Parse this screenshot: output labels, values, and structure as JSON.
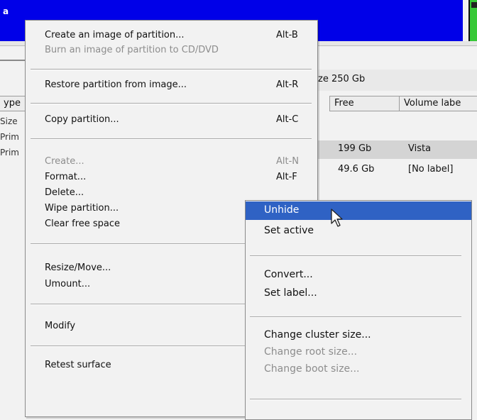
{
  "app": {
    "title_fragment": "a"
  },
  "disk": {
    "size_label": "ze 250 Gb"
  },
  "columns": {
    "type": "ype",
    "free": "Free",
    "volume_label": "Volume labe"
  },
  "left_strip": [
    "Size",
    "Prim",
    "Prim"
  ],
  "partitions": [
    {
      "free": "199 Gb",
      "label": "Vista"
    },
    {
      "free": "49.6 Gb",
      "label": "[No label]"
    }
  ],
  "menu": {
    "create_image": {
      "label": "Create an image of partition...",
      "shortcut": "Alt-B"
    },
    "burn_image": {
      "label": "Burn an image of partition to CD/DVD"
    },
    "restore": {
      "label": "Restore partition from image...",
      "shortcut": "Alt-R"
    },
    "copy": {
      "label": "Copy partition...",
      "shortcut": "Alt-C"
    },
    "create": {
      "label": "Create...",
      "shortcut": "Alt-N"
    },
    "format": {
      "label": "Format...",
      "shortcut": "Alt-F"
    },
    "delete": {
      "label": "Delete..."
    },
    "wipe": {
      "label": "Wipe partition..."
    },
    "clear_free": {
      "label": "Clear free space"
    },
    "resize": {
      "label": "Resize/Move..."
    },
    "umount": {
      "label": "Umount..."
    },
    "modify": {
      "label": "Modify"
    },
    "retest": {
      "label": "Retest surface"
    }
  },
  "submenu": {
    "unhide": "Unhide",
    "set_active": "Set active",
    "convert": "Convert...",
    "set_label": "Set label...",
    "change_cluster": "Change cluster size...",
    "change_root": "Change root size...",
    "change_boot": "Change boot size..."
  },
  "colors": {
    "titlebar": "#0000e8",
    "highlight": "#2f62c4",
    "disabled_text": "#8d8d8d"
  }
}
